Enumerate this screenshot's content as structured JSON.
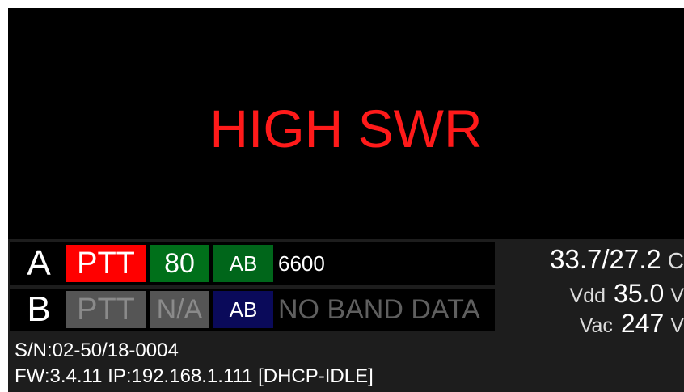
{
  "display": {
    "alert": "HIGH SWR"
  },
  "channels": [
    {
      "label": "A",
      "ptt": "PTT",
      "band": "80",
      "mode": "AB",
      "info": "6600"
    },
    {
      "label": "B",
      "ptt": "PTT",
      "band": "N/A",
      "mode": "AB",
      "info": "NO BAND DATA"
    }
  ],
  "stats": {
    "temperature": "33.7/27.2",
    "temperature_unit": "C",
    "vdd_label": "Vdd",
    "vdd_value": "35.0",
    "vdd_unit": "V",
    "vac_label": "Vac",
    "vac_value": "247",
    "vac_unit": "V"
  },
  "footer": {
    "serial": "S/N:02-50/18-0004",
    "firmware": "FW:3.4.11  IP:192.168.1.111 [DHCP-IDLE]"
  },
  "colors": {
    "alert": "#ff1a1a",
    "ptt_active": "#ff0000",
    "band_active": "#00701a",
    "mode_a": "#00661a",
    "mode_b": "#0a0a5a",
    "inactive": "#555555"
  }
}
